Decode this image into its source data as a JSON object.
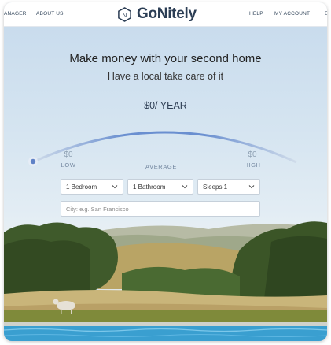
{
  "nav": {
    "left_links": [
      "ANAGER",
      "ABOUT US"
    ],
    "brand": "GoNitely",
    "right_links": [
      "HELP",
      "MY ACCOUNT",
      "E"
    ]
  },
  "hero": {
    "title": "Make money with your second home",
    "subtitle": "Have a local take care of it",
    "amount": "$0/ YEAR",
    "low_value": "$0",
    "low_label": "LOW",
    "average_label": "AVERAGE",
    "high_value": "$0",
    "high_label": "HIGH",
    "slider_position": 0
  },
  "form": {
    "bedrooms": "1 Bedroom",
    "bathrooms": "1 Bathroom",
    "sleeps": "Sleeps 1",
    "city_placeholder": "City: e.g. San Francisco"
  },
  "colors": {
    "accent": "#6a8fd0",
    "nav_text": "#33465b",
    "brand_text": "#2c3e55"
  }
}
